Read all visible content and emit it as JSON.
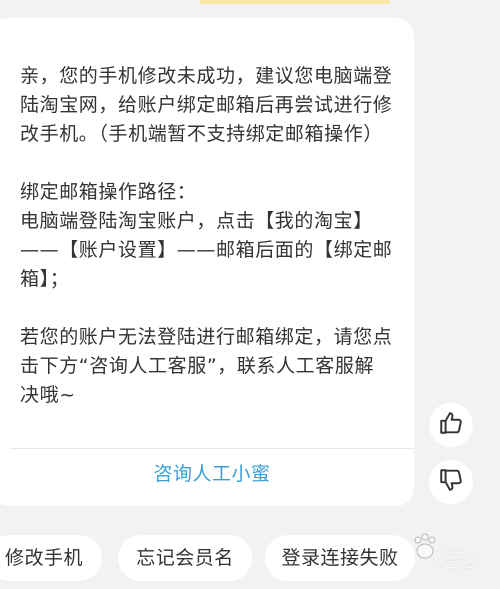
{
  "message": {
    "line_1": "亲，您的手机修改未成功，建议您电脑端登",
    "line_2": "陆淘宝网，给账户绑定邮箱后再尝试进行修",
    "line_3": "改手机。（手机端暂不支持绑定邮箱操作）",
    "line_4": "绑定邮箱操作路径：",
    "line_5": "电脑端登陆淘宝账户，点击【我的淘宝】",
    "line_6": "——【账户设置】——邮箱后面的【绑定邮",
    "line_7": "箱】；",
    "line_8": "若您的账户无法登陆进行邮箱绑定，请您点",
    "line_9": "击下方“咨询人工客服”，联系人工客服解",
    "line_10": "决哦~"
  },
  "consult_link_label": "咨询人工小蜜",
  "feedback": {
    "like_icon": "thumbs-up-icon",
    "dislike_icon": "thumbs-down-icon"
  },
  "quick_replies": [
    "修改手机",
    "忘记会员名",
    "登录连接失败"
  ],
  "watermark_text": "经验",
  "colors": {
    "background": "#f2f2f2",
    "card": "#ffffff",
    "text": "#333333",
    "link": "#3a9fd6"
  }
}
